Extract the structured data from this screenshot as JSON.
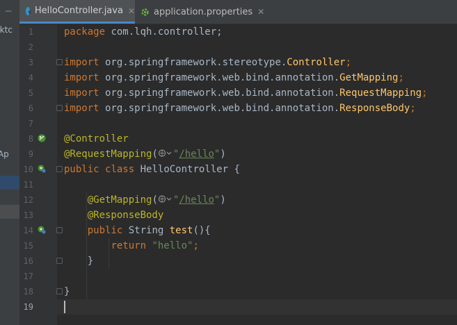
{
  "tabs": [
    {
      "label": "HelloController.java",
      "active": true,
      "icon": "class-icon",
      "icon_color": "#3592c4"
    },
    {
      "label": "application.properties",
      "active": false,
      "icon": "spring-properties-icon",
      "icon_color": "#6db33f"
    }
  ],
  "project_panel": {
    "fragments": [
      "esktc",
      "ldAp"
    ]
  },
  "gutter": {
    "line_numbers": [
      "1",
      "2",
      "3",
      "4",
      "5",
      "6",
      "7",
      "8",
      "9",
      "10",
      "11",
      "12",
      "13",
      "14",
      "15",
      "16",
      "17",
      "18",
      "19"
    ]
  },
  "code": {
    "l1": {
      "kw": "package",
      "rest": " com.lqh.controller;"
    },
    "l3": {
      "kw": "import",
      "pkg": " org.springframework.stereotype.",
      "cls": "Controller",
      "end": ";"
    },
    "l4": {
      "kw": "import",
      "pkg": " org.springframework.web.bind.annotation.",
      "cls": "GetMapping",
      "end": ";"
    },
    "l5": {
      "kw": "import",
      "pkg": " org.springframework.web.bind.annotation.",
      "cls": "RequestMapping",
      "end": ";"
    },
    "l6": {
      "kw": "import",
      "pkg": " org.springframework.web.bind.annotation.",
      "cls": "ResponseBody",
      "end": ";"
    },
    "l8": {
      "ann": "@Controller"
    },
    "l9": {
      "ann": "@RequestMapping",
      "open": "(",
      "q1": "\"",
      "path": "/hello",
      "q2": "\"",
      "close": ")"
    },
    "l10": {
      "kw1": "public",
      "kw2": "class",
      "name": " HelloController {"
    },
    "l12": {
      "ann": "@GetMapping",
      "open": "(",
      "q1": "\"",
      "path": "/hello",
      "q2": "\"",
      "close": ")"
    },
    "l13": {
      "ann": "@ResponseBody"
    },
    "l14": {
      "kw": "public",
      "type": " String ",
      "fn": "test",
      "rest": "(){"
    },
    "l15": {
      "kw": "return",
      "str": "\"hello\"",
      "end": ";"
    },
    "l16": {
      "brace": "}"
    },
    "l18": {
      "brace": "}"
    }
  },
  "colors": {
    "keyword": "#cc7832",
    "annotation": "#bbb529",
    "string": "#6a8759",
    "function": "#ffc66d",
    "text": "#a9b7c6"
  }
}
